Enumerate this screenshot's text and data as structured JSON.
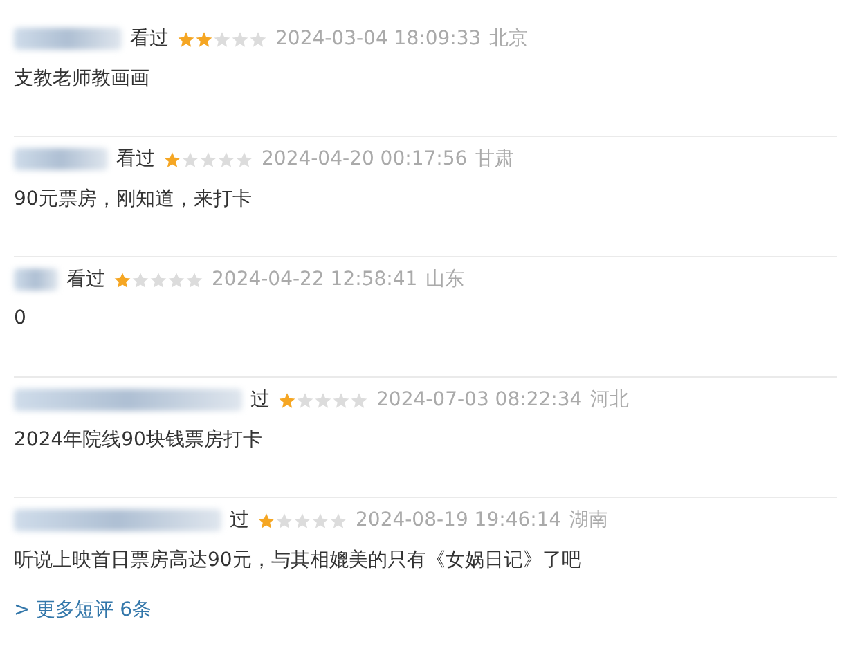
{
  "comments": [
    {
      "status": "看过",
      "stars": 2,
      "time": "2024-03-04 18:09:33",
      "location": "北京",
      "text": "支教老师教画画"
    },
    {
      "status": "看过",
      "stars": 1,
      "time": "2024-04-20 00:17:56",
      "location": "甘肃",
      "text": "90元票房，刚知道，来打卡"
    },
    {
      "status": "看过",
      "stars": 1,
      "time": "2024-04-22 12:58:41",
      "location": "山东",
      "text": "0"
    },
    {
      "status": "过",
      "stars": 1,
      "time": "2024-07-03 08:22:34",
      "location": "河北",
      "text": "2024年院线90块钱票房打卡"
    },
    {
      "status": "过",
      "stars": 1,
      "time": "2024-08-19 19:46:14",
      "location": "湖南",
      "text": "听说上映首日票房高达90元，与其相媲美的只有《女娲日记》了吧"
    }
  ],
  "more_link": "> 更多短评 6条"
}
